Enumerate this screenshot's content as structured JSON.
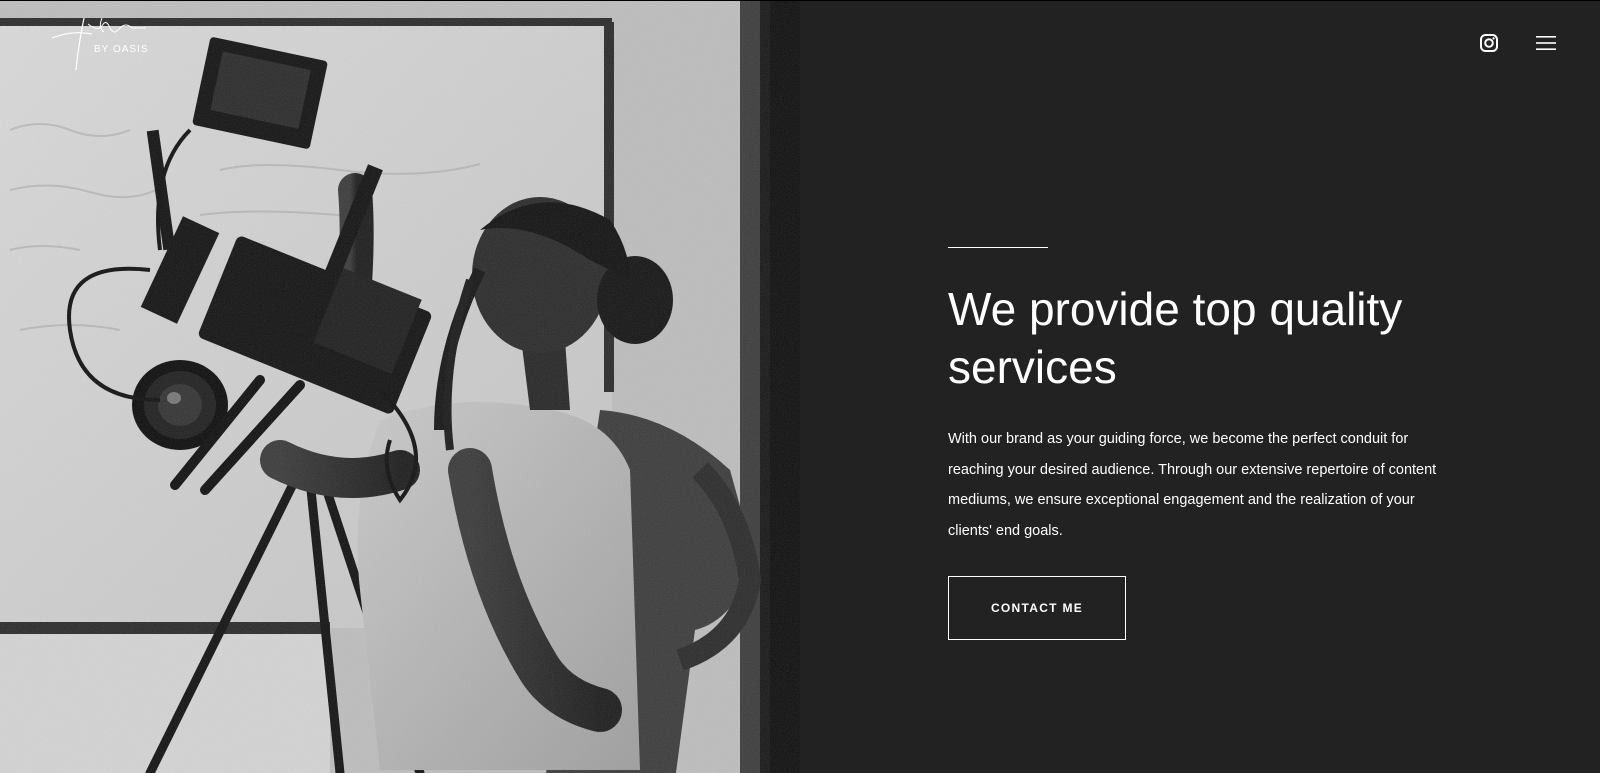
{
  "brand": {
    "logo_subtext": "BY OASIS"
  },
  "header": {
    "instagram_icon": "instagram-icon",
    "menu_icon": "hamburger-menu-icon"
  },
  "hero": {
    "headline": "We provide top quality services",
    "body": "With our brand as your guiding force, we become the perfect conduit for reaching your desired audience. Through our extensive repertoire of content mediums, we ensure exceptional engagement and the realization of your clients' end goals.",
    "cta_label": "CONTACT ME"
  },
  "colors": {
    "background": "#222222",
    "text": "#ffffff",
    "photo_tone": "grayscale"
  }
}
